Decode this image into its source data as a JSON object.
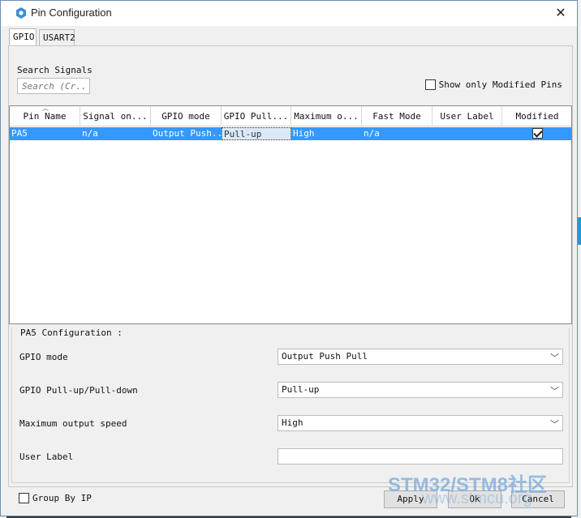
{
  "window": {
    "title": "Pin Configuration",
    "close_glyph": "✕",
    "icon": "gear-chip-icon"
  },
  "tabs": [
    {
      "label": "GPIO",
      "active": true
    },
    {
      "label": "USART2",
      "active": false
    }
  ],
  "search": {
    "label": "Search Signals",
    "placeholder": "Search (Cr..."
  },
  "show_modified": {
    "label": "Show only Modified Pins",
    "checked": false
  },
  "table": {
    "headers": [
      "Pin Name",
      "Signal on...",
      "GPIO mode",
      "GPIO Pull...",
      "Maximum o...",
      "Fast Mode",
      "User Label",
      "Modified"
    ],
    "rows": [
      {
        "pin_name": "PA5",
        "signal": "n/a",
        "gpio_mode": "Output Push...",
        "gpio_pull": "Pull-up",
        "max_speed": "High",
        "fast_mode": "n/a",
        "user_label": "",
        "modified": true
      }
    ]
  },
  "config": {
    "title": "PA5 Configuration :",
    "gpio_mode_label": "GPIO mode",
    "gpio_mode_value": "Output Push Pull",
    "pull_label": "GPIO Pull-up/Pull-down",
    "pull_value": "Pull-up",
    "speed_label": "Maximum output speed",
    "speed_value": "High",
    "user_label_label": "User Label",
    "user_label_value": ""
  },
  "footer": {
    "group_by_ip": "Group By IP",
    "apply": "Apply",
    "ok": "Ok",
    "cancel": "Cancel"
  },
  "watermark": {
    "text": "STM32/STM8社区",
    "url": "www.stmcu.org"
  },
  "colors": {
    "selection": "#3399ff",
    "window_bg": "#f0f0f0",
    "accent_border": "#6b8fb3"
  }
}
